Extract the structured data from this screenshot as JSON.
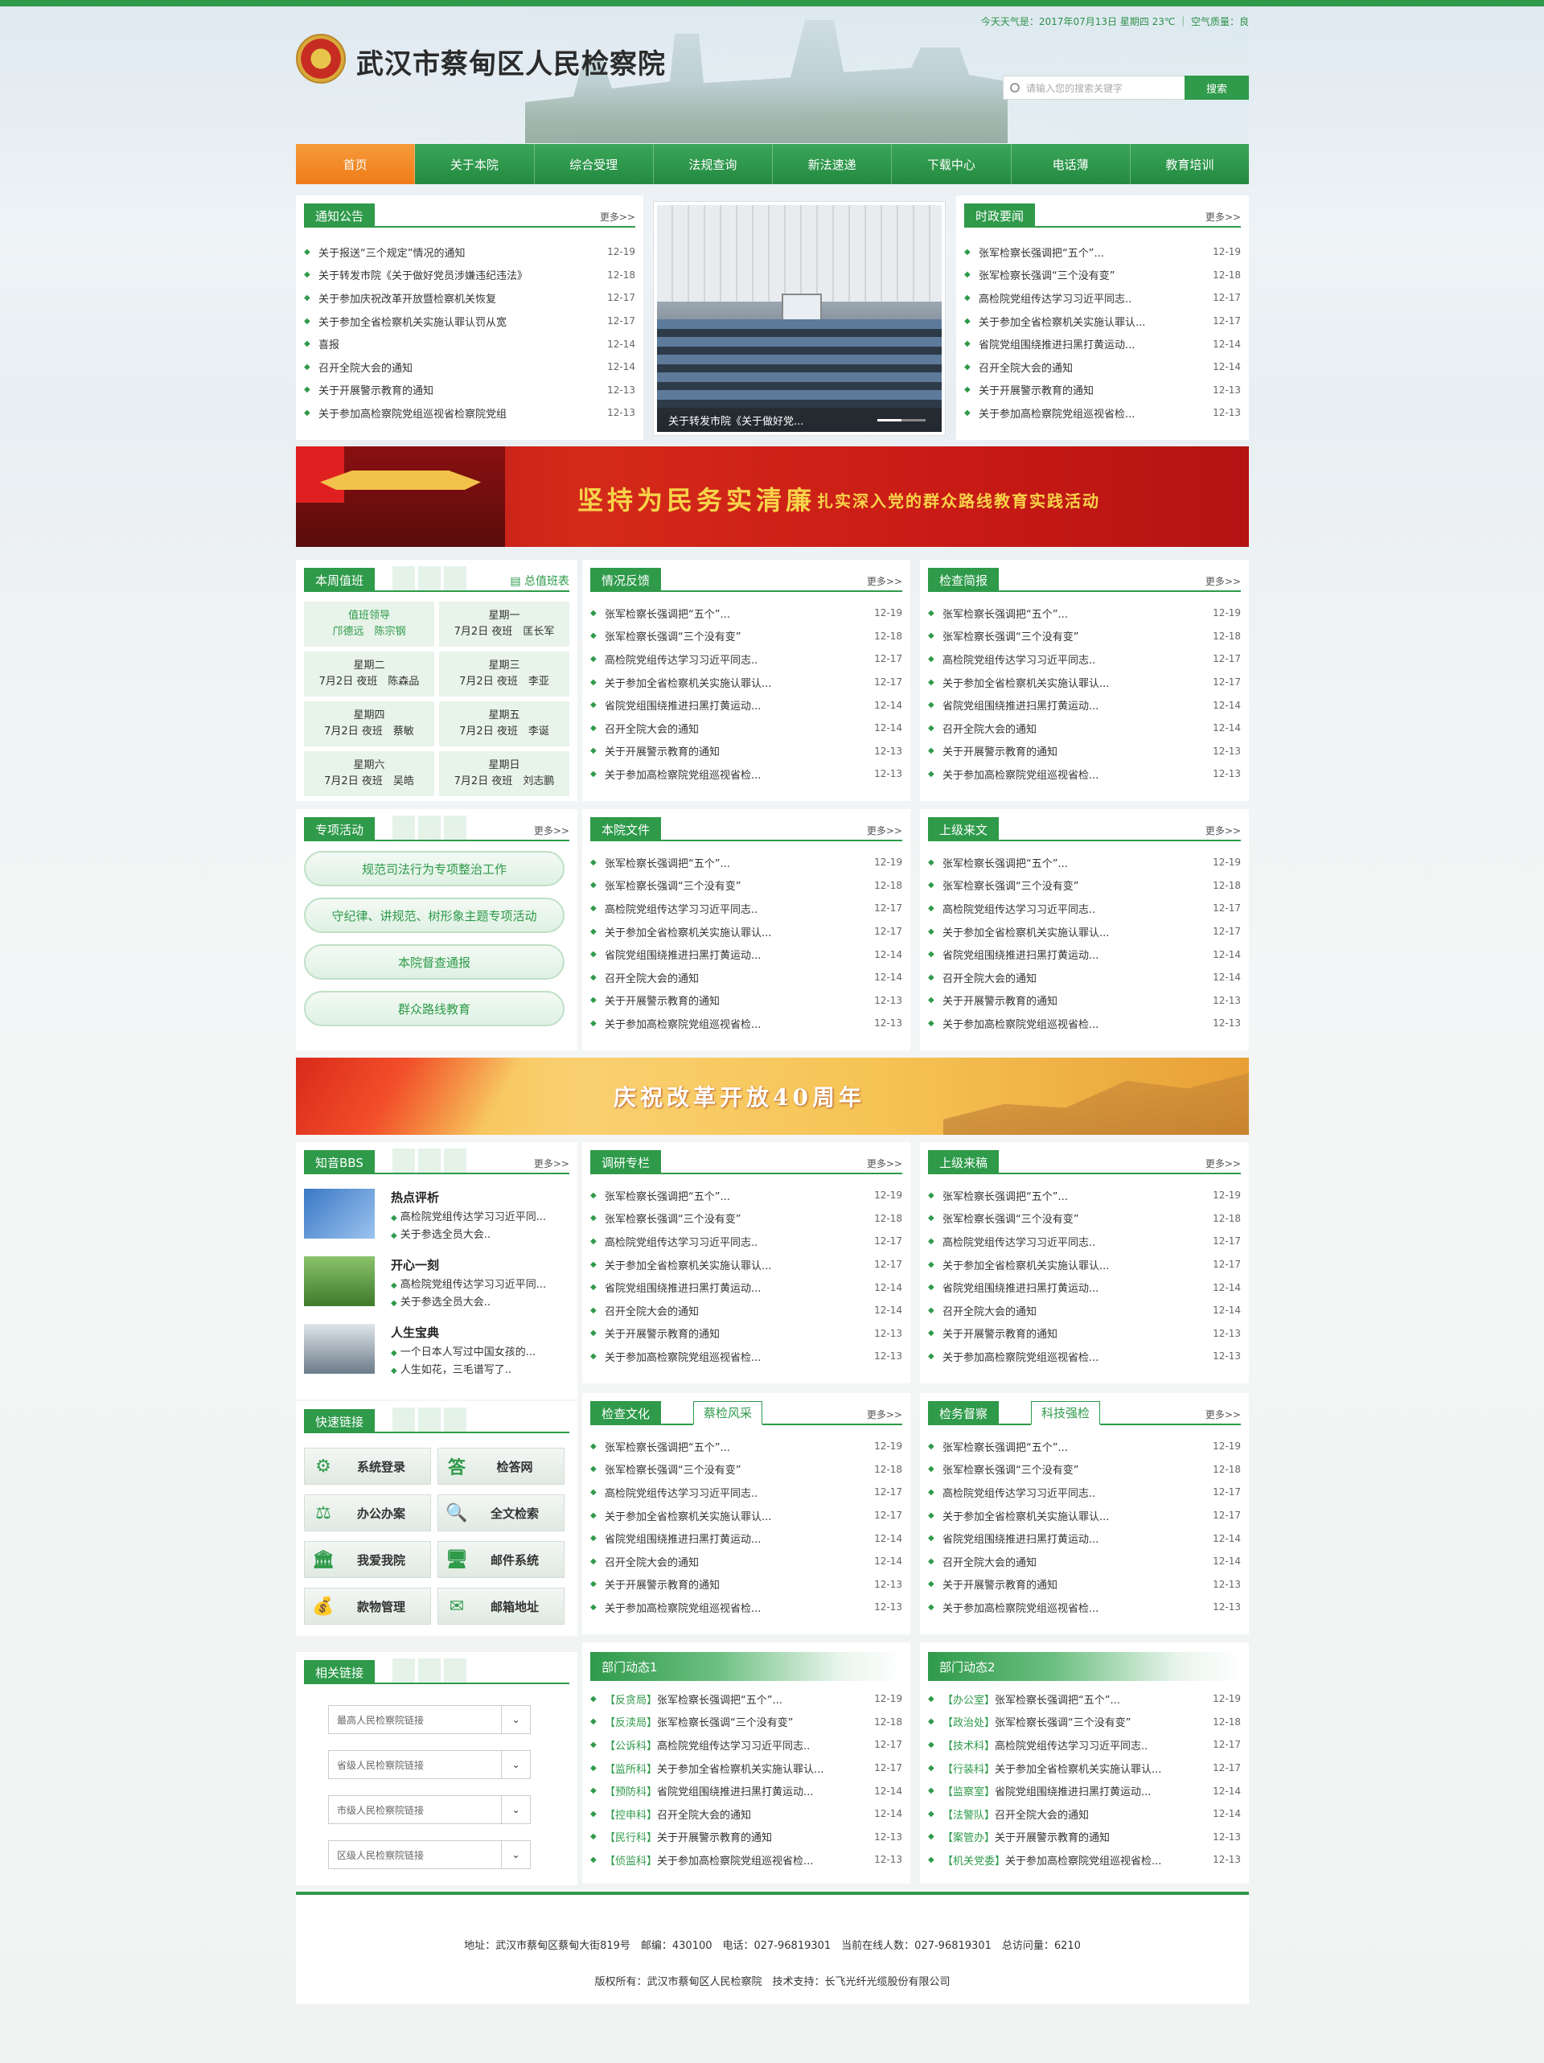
{
  "header": {
    "site_title": "武汉市蔡甸区人民检察院",
    "weather": "今天天气是：2017年07月13日 星期四 23℃ ｜ 空气质量：良",
    "search_placeholder": "请输入您的搜索关键字",
    "search_button": "搜索"
  },
  "nav": [
    "首页",
    "关于本院",
    "综合受理",
    "法规查询",
    "新法速递",
    "下载中心",
    "电话薄",
    "教育培训"
  ],
  "notice": {
    "title": "通知公告",
    "more": "更多>>",
    "items": [
      {
        "t": "关于报送“三个规定”情况的通知",
        "d": "12-19"
      },
      {
        "t": "关于转发市院《关于做好党员涉嫌违纪违法》",
        "d": "12-18"
      },
      {
        "t": "关于参加庆祝改革开放暨检察机关恢复",
        "d": "12-17"
      },
      {
        "t": "关于参加全省检察机关实施认罪认罚从宽",
        "d": "12-17"
      },
      {
        "t": "喜报",
        "d": "12-14"
      },
      {
        "t": "召开全院大会的通知",
        "d": "12-14"
      },
      {
        "t": "关于开展警示教育的通知",
        "d": "12-13"
      },
      {
        "t": "关于参加高检察院党组巡视省检察院党组",
        "d": "12-13"
      }
    ]
  },
  "slide": {
    "caption": "关于转发市院《关于做好党..."
  },
  "current_affairs": {
    "title": "时政要闻",
    "more": "更多>>",
    "items": [
      {
        "t": "张军检察长强调把“五个”...",
        "d": "12-19"
      },
      {
        "t": "张军检察长强调“三个没有变”",
        "d": "12-18"
      },
      {
        "t": "高检院党组传达学习习近平同志..",
        "d": "12-17"
      },
      {
        "t": "关于参加全省检察机关实施认罪认...",
        "d": "12-17"
      },
      {
        "t": "省院党组围绕推进扫黑打黄运动...",
        "d": "12-14"
      },
      {
        "t": "召开全院大会的通知",
        "d": "12-14"
      },
      {
        "t": "关于开展警示教育的通知",
        "d": "12-13"
      },
      {
        "t": "关于参加高检察院党组巡视省检...",
        "d": "12-13"
      }
    ]
  },
  "banner1": {
    "main": "坚持为民务实清廉",
    "sub": "扎实深入党的群众路线教育实践活动"
  },
  "banner2": {
    "text": "庆祝改革开放40周年"
  },
  "duty": {
    "title": "本周值班",
    "link": "总值班表",
    "cells": [
      {
        "a": "值班领导",
        "b": "邝德远　陈宗钢",
        "lead": true
      },
      {
        "a": "星期一",
        "b": "7月2日 夜班　匡长军"
      },
      {
        "a": "星期二",
        "b": "7月2日 夜班　陈森品"
      },
      {
        "a": "星期三",
        "b": "7月2日 夜班　李亚"
      },
      {
        "a": "星期四",
        "b": "7月2日 夜班　蔡敏"
      },
      {
        "a": "星期五",
        "b": "7月2日 夜班　李诞"
      },
      {
        "a": "星期六",
        "b": "7月2日 夜班　吴皓"
      },
      {
        "a": "星期日",
        "b": "7月2日 夜班　刘志鹏"
      }
    ]
  },
  "special": {
    "title": "专项活动",
    "more": "更多>>",
    "items": [
      "规范司法行为专项整治工作",
      "守纪律、讲规范、树形象主题专项活动",
      "本院督查通报",
      "群众路线教育"
    ]
  },
  "feedback": {
    "title": "情况反馈",
    "more": "更多>>",
    "items": [
      {
        "t": "张军检察长强调把“五个”...",
        "d": "12-19"
      },
      {
        "t": "张军检察长强调“三个没有变”",
        "d": "12-18"
      },
      {
        "t": "高检院党组传达学习习近平同志..",
        "d": "12-17"
      },
      {
        "t": "关于参加全省检察机关实施认罪认...",
        "d": "12-17"
      },
      {
        "t": "省院党组围绕推进扫黑打黄运动...",
        "d": "12-14"
      },
      {
        "t": "召开全院大会的通知",
        "d": "12-14"
      },
      {
        "t": "关于开展警示教育的通知",
        "d": "12-13"
      },
      {
        "t": "关于参加高检察院党组巡视省检...",
        "d": "12-13"
      }
    ]
  },
  "briefing": {
    "title": "检查简报",
    "more": "更多>>",
    "items": [
      {
        "t": "张军检察长强调把“五个”...",
        "d": "12-19"
      },
      {
        "t": "张军检察长强调“三个没有变”",
        "d": "12-18"
      },
      {
        "t": "高检院党组传达学习习近平同志..",
        "d": "12-17"
      },
      {
        "t": "关于参加全省检察机关实施认罪认...",
        "d": "12-17"
      },
      {
        "t": "省院党组围绕推进扫黑打黄运动...",
        "d": "12-14"
      },
      {
        "t": "召开全院大会的通知",
        "d": "12-14"
      },
      {
        "t": "关于开展警示教育的通知",
        "d": "12-13"
      },
      {
        "t": "关于参加高检察院党组巡视省检...",
        "d": "12-13"
      }
    ]
  },
  "docs": {
    "title": "本院文件",
    "more": "更多>>",
    "items": [
      {
        "t": "张军检察长强调把“五个”...",
        "d": "12-19"
      },
      {
        "t": "张军检察长强调“三个没有变”",
        "d": "12-18"
      },
      {
        "t": "高检院党组传达学习习近平同志..",
        "d": "12-17"
      },
      {
        "t": "关于参加全省检察机关实施认罪认...",
        "d": "12-17"
      },
      {
        "t": "省院党组围绕推进扫黑打黄运动...",
        "d": "12-14"
      },
      {
        "t": "召开全院大会的通知",
        "d": "12-14"
      },
      {
        "t": "关于开展警示教育的通知",
        "d": "12-13"
      },
      {
        "t": "关于参加高检察院党组巡视省检...",
        "d": "12-13"
      }
    ]
  },
  "superior": {
    "title": "上级来文",
    "more": "更多>>",
    "items": [
      {
        "t": "张军检察长强调把“五个”...",
        "d": "12-19"
      },
      {
        "t": "张军检察长强调“三个没有变”",
        "d": "12-18"
      },
      {
        "t": "高检院党组传达学习习近平同志..",
        "d": "12-17"
      },
      {
        "t": "关于参加全省检察机关实施认罪认...",
        "d": "12-17"
      },
      {
        "t": "省院党组围绕推进扫黑打黄运动...",
        "d": "12-14"
      },
      {
        "t": "召开全院大会的通知",
        "d": "12-14"
      },
      {
        "t": "关于开展警示教育的通知",
        "d": "12-13"
      },
      {
        "t": "关于参加高检察院党组巡视省检...",
        "d": "12-13"
      }
    ]
  },
  "bbs": {
    "title": "知音BBS",
    "more": "更多>>",
    "items": [
      {
        "h": "热点评析",
        "l1": "高检院党组传达学习习近平同...",
        "l2": "关于参选全员大会.."
      },
      {
        "h": "开心一刻",
        "l1": "高检院党组传达学习习近平同...",
        "l2": "关于参选全员大会.."
      },
      {
        "h": "人生宝典",
        "l1": "一个日本人写过中国女孩的...",
        "l2": "人生如花，三毛谱写了.."
      }
    ]
  },
  "research": {
    "title": "调研专栏",
    "more": "更多>>",
    "items": [
      {
        "t": "张军检察长强调把“五个”...",
        "d": "12-19"
      },
      {
        "t": "张军检察长强调“三个没有变”",
        "d": "12-18"
      },
      {
        "t": "高检院党组传达学习习近平同志..",
        "d": "12-17"
      },
      {
        "t": "关于参加全省检察机关实施认罪认...",
        "d": "12-17"
      },
      {
        "t": "省院党组围绕推进扫黑打黄运动...",
        "d": "12-14"
      },
      {
        "t": "召开全院大会的通知",
        "d": "12-14"
      },
      {
        "t": "关于开展警示教育的通知",
        "d": "12-13"
      },
      {
        "t": "关于参加高检察院党组巡视省检...",
        "d": "12-13"
      }
    ]
  },
  "manuscripts": {
    "title": "上级来稿",
    "more": "更多>>",
    "items": [
      {
        "t": "张军检察长强调把“五个”...",
        "d": "12-19"
      },
      {
        "t": "张军检察长强调“三个没有变”",
        "d": "12-18"
      },
      {
        "t": "高检院党组传达学习习近平同志..",
        "d": "12-17"
      },
      {
        "t": "关于参加全省检察机关实施认罪认...",
        "d": "12-17"
      },
      {
        "t": "省院党组围绕推进扫黑打黄运动...",
        "d": "12-14"
      },
      {
        "t": "召开全院大会的通知",
        "d": "12-14"
      },
      {
        "t": "关于开展警示教育的通知",
        "d": "12-13"
      },
      {
        "t": "关于参加高检察院党组巡视省检...",
        "d": "12-13"
      }
    ]
  },
  "quick": {
    "title": "快速链接",
    "items": [
      {
        "label": "系统登录",
        "icon": "gear-icon",
        "glyph": "⚙"
      },
      {
        "label": "检答网",
        "icon": "answer-icon",
        "glyph": "答"
      },
      {
        "label": "办公办案",
        "icon": "gavel-icon",
        "glyph": "⚖"
      },
      {
        "label": "全文检索",
        "icon": "search-doc-icon",
        "glyph": "🔍"
      },
      {
        "label": "我爱我院",
        "icon": "building-icon",
        "glyph": "🏛"
      },
      {
        "label": "邮件系统",
        "icon": "monitor-icon",
        "glyph": "🖥"
      },
      {
        "label": "款物管理",
        "icon": "money-icon",
        "glyph": "💰"
      },
      {
        "label": "邮箱地址",
        "icon": "mail-icon",
        "glyph": "✉"
      }
    ]
  },
  "culture": {
    "title": "检查文化",
    "tab2": "蔡检风采",
    "more": "更多>>",
    "items": [
      {
        "t": "张军检察长强调把“五个”...",
        "d": "12-19"
      },
      {
        "t": "张军检察长强调“三个没有变”",
        "d": "12-18"
      },
      {
        "t": "高检院党组传达学习习近平同志..",
        "d": "12-17"
      },
      {
        "t": "关于参加全省检察机关实施认罪认...",
        "d": "12-17"
      },
      {
        "t": "省院党组围绕推进扫黑打黄运动...",
        "d": "12-14"
      },
      {
        "t": "召开全院大会的通知",
        "d": "12-14"
      },
      {
        "t": "关于开展警示教育的通知",
        "d": "12-13"
      },
      {
        "t": "关于参加高检察院党组巡视省检...",
        "d": "12-13"
      }
    ]
  },
  "supervision": {
    "title": "检务督察",
    "tab2": "科技强检",
    "more": "更多>>",
    "items": [
      {
        "t": "张军检察长强调把“五个”...",
        "d": "12-19"
      },
      {
        "t": "张军检察长强调“三个没有变”",
        "d": "12-18"
      },
      {
        "t": "高检院党组传达学习习近平同志..",
        "d": "12-17"
      },
      {
        "t": "关于参加全省检察机关实施认罪认...",
        "d": "12-17"
      },
      {
        "t": "省院党组围绕推进扫黑打黄运动...",
        "d": "12-14"
      },
      {
        "t": "召开全院大会的通知",
        "d": "12-14"
      },
      {
        "t": "关于开展警示教育的通知",
        "d": "12-13"
      },
      {
        "t": "关于参加高检察院党组巡视省检...",
        "d": "12-13"
      }
    ]
  },
  "related": {
    "title": "相关链接",
    "options": [
      "最高人民检察院链接",
      "省级人民检察院链接",
      "市级人民检察院链接",
      "区级人民检察院链接"
    ]
  },
  "dept1": {
    "title": "部门动态1",
    "items": [
      {
        "g": "【反贪局】",
        "t": "张军检察长强调把“五个”...",
        "d": "12-19"
      },
      {
        "g": "【反渎局】",
        "t": "张军检察长强调“三个没有变”",
        "d": "12-18"
      },
      {
        "g": "【公诉科】",
        "t": "高检院党组传达学习习近平同志..",
        "d": "12-17"
      },
      {
        "g": "【监所科】",
        "t": "关于参加全省检察机关实施认罪认...",
        "d": "12-17"
      },
      {
        "g": "【预防科】",
        "t": "省院党组围绕推进扫黑打黄运动...",
        "d": "12-14"
      },
      {
        "g": "【控申科】",
        "t": "召开全院大会的通知",
        "d": "12-14"
      },
      {
        "g": "【民行科】",
        "t": "关于开展警示教育的通知",
        "d": "12-13"
      },
      {
        "g": "【侦监科】",
        "t": "关于参加高检察院党组巡视省检...",
        "d": "12-13"
      }
    ]
  },
  "dept2": {
    "title": "部门动态2",
    "items": [
      {
        "g": "【办公室】",
        "t": "张军检察长强调把“五个”...",
        "d": "12-19"
      },
      {
        "g": "【政治处】",
        "t": "张军检察长强调“三个没有变”",
        "d": "12-18"
      },
      {
        "g": "【技术科】",
        "t": "高检院党组传达学习习近平同志..",
        "d": "12-17"
      },
      {
        "g": "【行装科】",
        "t": "关于参加全省检察机关实施认罪认...",
        "d": "12-17"
      },
      {
        "g": "【监察室】",
        "t": "省院党组围绕推进扫黑打黄运动...",
        "d": "12-14"
      },
      {
        "g": "【法警队】",
        "t": "召开全院大会的通知",
        "d": "12-14"
      },
      {
        "g": "【案管办】",
        "t": "关于开展警示教育的通知",
        "d": "12-13"
      },
      {
        "g": "【机关党委】",
        "t": "关于参加高检察院党组巡视省检...",
        "d": "12-13"
      }
    ]
  },
  "footer": {
    "line1": "地址：武汉市蔡甸区蔡甸大街819号　邮编：430100　电话：027-96819301　当前在线人数：027-96819301　总访问量：6210",
    "line2": "版权所有：武汉市蔡甸区人民检察院　技术支持：长飞光纤光缆股份有限公司"
  },
  "colors": {
    "brand_green": "#2e9a4a",
    "active_orange": "#f07b18"
  }
}
